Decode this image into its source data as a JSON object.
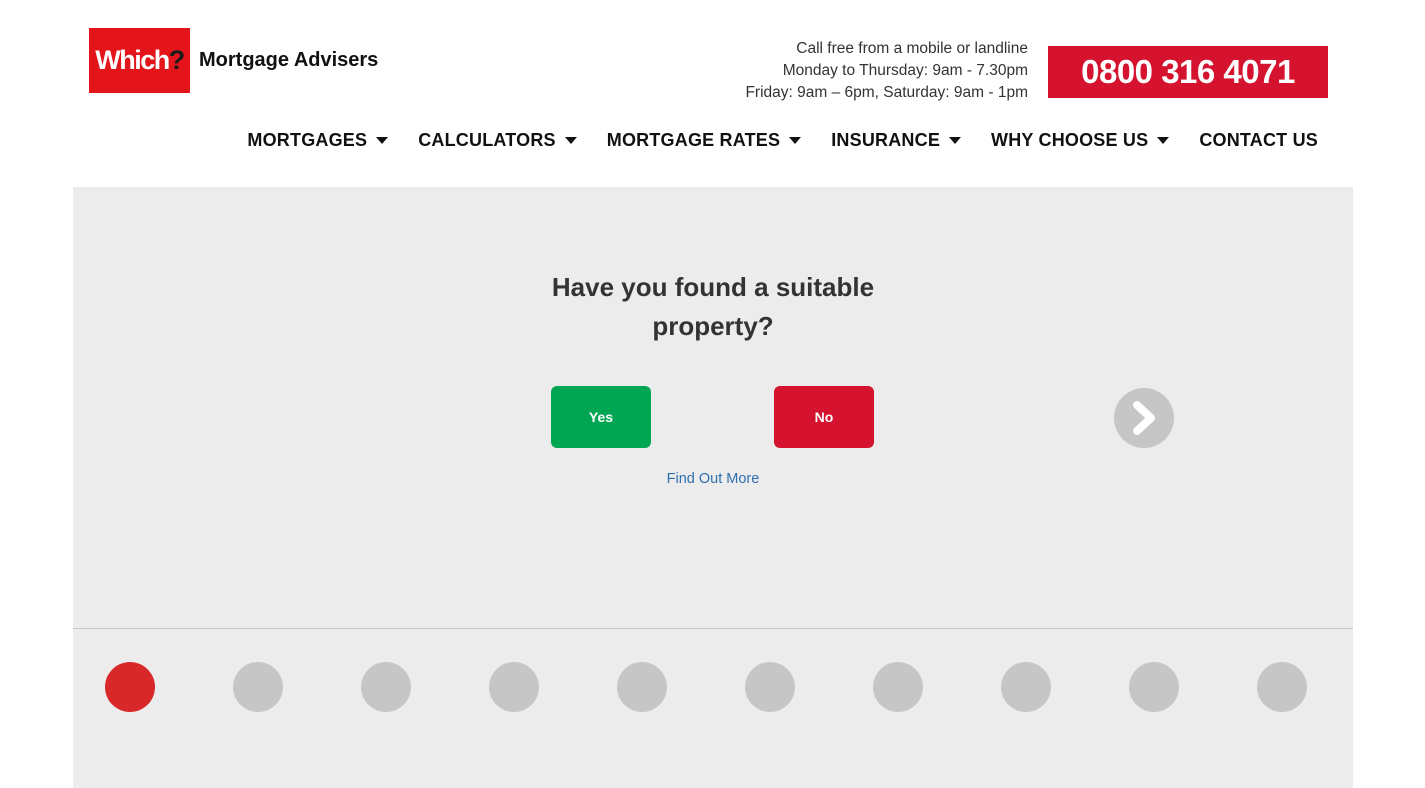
{
  "header": {
    "logo_mark": "Which",
    "logo_mark_q": "?",
    "logo_text": "Mortgage Advisers",
    "call_line1": "Call free from a mobile or landline",
    "call_line2": "Monday to Thursday: 9am - 7.30pm",
    "call_line3": "Friday: 9am – 6pm, Saturday: 9am - 1pm",
    "phone": "0800 316 4071"
  },
  "nav": {
    "items": [
      {
        "label": "MORTGAGES",
        "dropdown": true
      },
      {
        "label": "CALCULATORS",
        "dropdown": true
      },
      {
        "label": "MORTGAGE RATES",
        "dropdown": true
      },
      {
        "label": "INSURANCE",
        "dropdown": true
      },
      {
        "label": "WHY CHOOSE US",
        "dropdown": true
      },
      {
        "label": "CONTACT US",
        "dropdown": false
      }
    ]
  },
  "question": {
    "text": "Have you found a suitable property?",
    "yes_label": "Yes",
    "no_label": "No",
    "find_out_more": "Find Out More"
  },
  "progress": {
    "total_steps": 10,
    "current_step": 1
  },
  "colors": {
    "brand_red": "#e3151b",
    "phone_red": "#d5132f",
    "yes_green": "#00a651",
    "link_blue": "#2f6fb0",
    "panel_bg": "#ececec",
    "dot_inactive": "#c6c6c6",
    "dot_active": "#d8282a"
  },
  "icons": {
    "nav_caret": "caret-down-icon",
    "next": "chevron-right-icon"
  }
}
